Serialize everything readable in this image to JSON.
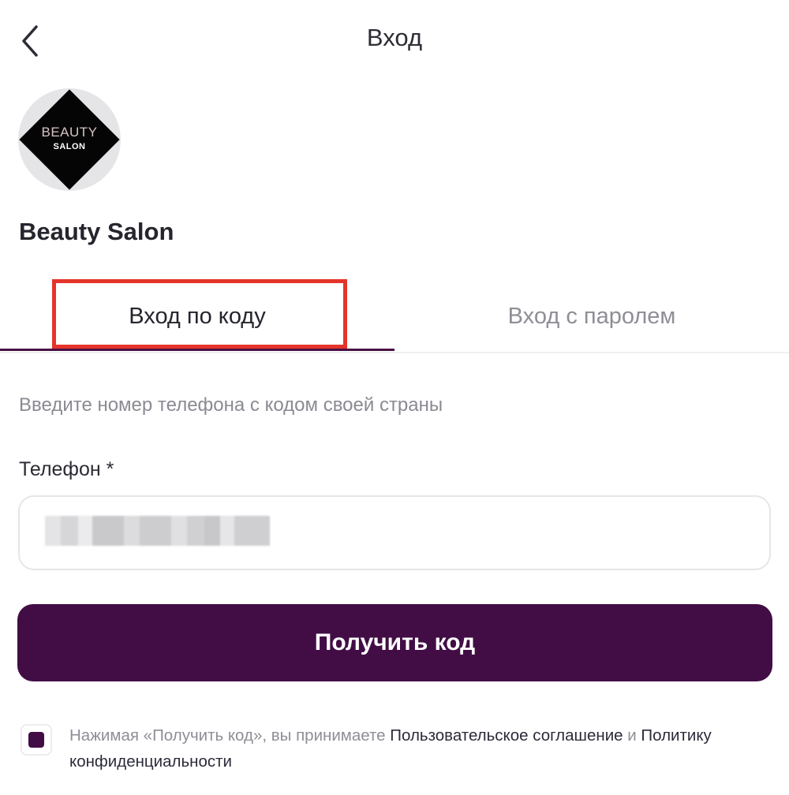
{
  "header": {
    "title": "Вход",
    "back_icon": "chevron-left-icon"
  },
  "salon": {
    "logo_line_1": "BEAUTY",
    "logo_line_2": "SALON",
    "name": "Beauty Salon"
  },
  "tabs": [
    {
      "label": "Вход по коду",
      "active": true
    },
    {
      "label": "Вход с паролем",
      "active": false
    }
  ],
  "form": {
    "hint": "Введите номер телефона с кодом своей страны",
    "phone_label": "Телефон *",
    "phone_value_obscured": true,
    "submit_label": "Получить код"
  },
  "consent": {
    "checked": true,
    "prefix": "Нажимая «Получить код», вы принимаете ",
    "agreement_link": "Пользовательское соглашение",
    "conjunction": " и ",
    "privacy_link": "Политику конфиденциальности"
  },
  "colors": {
    "accent": "#420d45",
    "highlight": "#e5342b",
    "muted_text": "#8e8e96"
  }
}
